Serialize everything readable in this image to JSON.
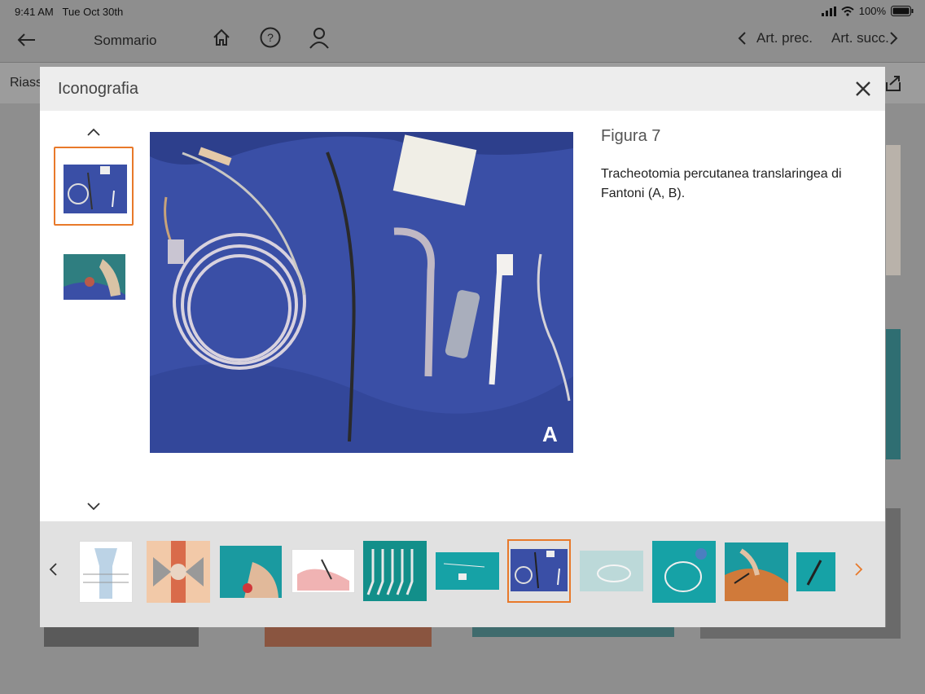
{
  "status": {
    "time": "9:41 AM",
    "date": "Tue Oct 30th",
    "battery": "100%"
  },
  "appbar": {
    "summary": "Sommario",
    "prev": "Art. prec.",
    "next": "Art. succ."
  },
  "subbar": {
    "label": "Riass"
  },
  "modal": {
    "title": "Iconografia",
    "figure_title": "Figura 7",
    "caption": "Tracheotomia percutanea translaringea di Fantoni (A, B).",
    "image_letter": "A"
  },
  "colors": {
    "accent": "#e8792a",
    "drape": "#3a4fa6",
    "teal": "#1a9aa0"
  },
  "icons": [
    "back-arrow-icon",
    "home-icon",
    "help-icon",
    "user-icon",
    "chevron-left-icon",
    "chevron-right-icon",
    "close-icon",
    "chevron-up-icon",
    "chevron-down-icon",
    "share-icon",
    "wifi-icon",
    "battery-icon",
    "signal-icon"
  ]
}
